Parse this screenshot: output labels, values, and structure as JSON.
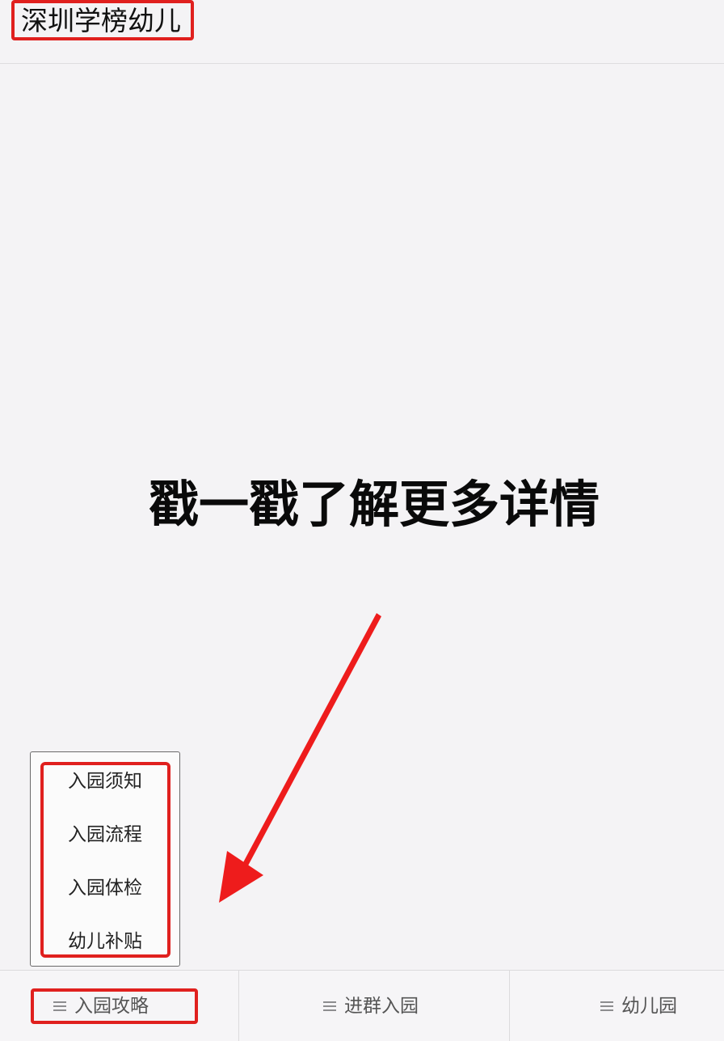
{
  "header": {
    "account_name": "深圳学榜幼儿"
  },
  "main": {
    "headline": "戳一戳了解更多详情"
  },
  "submenu": {
    "items": [
      {
        "label": "入园须知"
      },
      {
        "label": "入园流程"
      },
      {
        "label": "入园体检"
      },
      {
        "label": "幼儿补贴"
      }
    ]
  },
  "tabbar": {
    "tabs": [
      {
        "label": "入园攻略",
        "icon": "menu-icon"
      },
      {
        "label": "进群入园",
        "icon": "menu-icon"
      },
      {
        "label": "幼儿园",
        "icon": "menu-icon"
      }
    ]
  },
  "colors": {
    "highlight": "#e0201e",
    "background": "#f4f3f5",
    "arrow": "#ee1c1c"
  }
}
